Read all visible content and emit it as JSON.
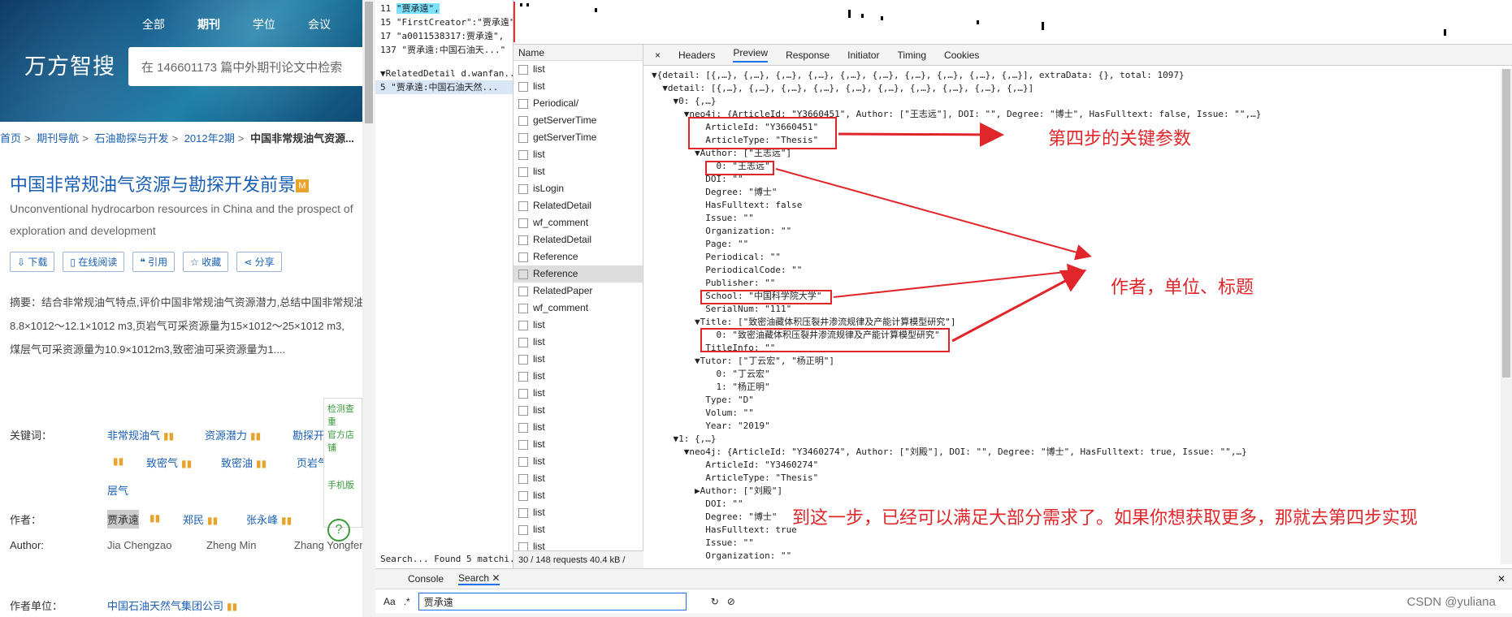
{
  "left": {
    "nav": [
      "全部",
      "期刊",
      "学位",
      "会议"
    ],
    "logo": "万方智搜",
    "search_placeholder": "在 146601173 篇中外期刊论文中检索",
    "breadcrumb": [
      "首页",
      "期刊导航",
      "石油勘探与开发",
      "2012年2期"
    ],
    "breadcrumb_current": "中国非常规油气资源...",
    "title": "中国非常规油气资源与勘探开发前景",
    "title_badge": "M",
    "en_title": "Unconventional hydrocarbon resources in China and the prospect of exploration and development",
    "actions": [
      "下载",
      "在线阅读",
      "引用",
      "收藏",
      "分享"
    ],
    "abstract_label": "摘要：",
    "abstract_lines": [
      "结合非常规油气特点,评价中国非常规油气资源潜力,总结中国非常规油气勘探开发技术进展,阐述中国非常规油气勘探开发前景与未来的发展战略。研究表明,中国非常规油气资源丰富,发展潜力大,其中致密气可采资源量为",
      "8.8×1012～12.1×1012 m3,页岩气可采资源量为15×1012～25×1012 m3,",
      "煤层气可采资源量为10.9×1012m3,致密油可采资源量为1...."
    ],
    "keywords_label": "关键词：",
    "keywords": [
      "非常规油气",
      "资源潜力",
      "勘探开发",
      "致密气",
      "致密油",
      "页岩气",
      "层气"
    ],
    "authors_label": "作者：",
    "authors": [
      "贾承遠",
      "郑民",
      "张永峰"
    ],
    "author_en_label": "Author:",
    "authors_en": [
      "Jia Chengzao",
      "Zheng Min",
      "Zhang Yongfeng"
    ],
    "org_label": "作者单位：",
    "org": "中国石油天然气集团公司",
    "side": [
      "检测查重",
      "官方店铺",
      "手机版"
    ]
  },
  "search_results": [
    {
      "ln": "11",
      "text": "\"贾承遠\","
    },
    {
      "ln": "15",
      "text": "\"FirstCreator\":\"贾承遠\","
    },
    {
      "ln": "17",
      "text": "\"a0011538317:贾承遠\","
    },
    {
      "ln": "137",
      "text": "\"贾承遠:中国石油天...\""
    }
  ],
  "search_group": "▼RelatedDetail   d.wanfan...",
  "search_group_row": "5 \"贾承遠:中国石油天然...",
  "network": {
    "name_header": "Name",
    "requests": [
      "list",
      "list",
      "Periodical/",
      "getServerTime",
      "getServerTime",
      "list",
      "list",
      "isLogin",
      "RelatedDetail",
      "wf_comment",
      "RelatedDetail",
      "Reference",
      "Reference",
      "RelatedPaper",
      "wf_comment",
      "list",
      "list",
      "list",
      "list",
      "list",
      "list",
      "list",
      "list",
      "list",
      "list",
      "list",
      "list",
      "list",
      "list"
    ],
    "status": "30 / 148 requests   40.4 kB /"
  },
  "preview_tabs": [
    "×",
    "Headers",
    "Preview",
    "Response",
    "Initiator",
    "Timing",
    "Cookies"
  ],
  "json_lines": [
    "▼{detail: [{,…}, {,…}, {,…}, {,…}, {,…}, {,…}, {,…}, {,…}, {,…}, {,…}], extraData: {}, total: 1097}",
    "  ▼detail: [{,…}, {,…}, {,…}, {,…}, {,…}, {,…}, {,…}, {,…}, {,…}, {,…}]",
    "    ▼0: {,…}",
    "      ▼neo4j: {ArticleId: \"Y3660451\", Author: [\"王志远\"], DOI: \"\", Degree: \"博士\", HasFulltext: false, Issue: \"\",…}",
    "          ArticleId: \"Y3660451\"",
    "          ArticleType: \"Thesis\"",
    "        ▼Author: [\"王志远\"]",
    "            0: \"王志远\"",
    "          DOI: \"\"",
    "          Degree: \"博士\"",
    "          HasFulltext: false",
    "          Issue: \"\"",
    "          Organization: \"\"",
    "          Page: \"\"",
    "          Periodical: \"\"",
    "          PeriodicalCode: \"\"",
    "          Publisher: \"\"",
    "          School: \"中国科学院大学\"",
    "          SerialNum: \"111\"",
    "        ▼Title: [\"致密油藏体积压裂井渗流规律及产能计算模型研究\"]",
    "            0: \"致密油藏体积压裂井渗流规律及产能计算模型研究\"",
    "          TitleInfo: \"\"",
    "        ▼Tutor: [\"丁云宏\", \"杨正明\"]",
    "            0: \"丁云宏\"",
    "            1: \"杨正明\"",
    "          Type: \"D\"",
    "          Volum: \"\"",
    "          Year: \"2019\"",
    "    ▼1: {,…}",
    "      ▼neo4j: {ArticleId: \"Y3460274\", Author: [\"刘殿\"], DOI: \"\", Degree: \"博士\", HasFulltext: true, Issue: \"\",…}",
    "          ArticleId: \"Y3460274\"",
    "          ArticleType: \"Thesis\"",
    "        ▶Author: [\"刘殿\"]",
    "          DOI: \"\"",
    "          Degree: \"博士\"",
    "          HasFulltext: true",
    "          Issue: \"\"",
    "          Organization: \"\""
  ],
  "annotations": {
    "key_params": "第四步的关键参数",
    "author_org_title": "作者，单位、标题",
    "summary": "到这一步，已经可以满足大部分需求了。如果你想获取更多，那就去第四步实现"
  },
  "bottom": {
    "tabs": [
      "Console",
      "Search"
    ],
    "search_label": "Aa",
    "search_regex": ".*",
    "search_value": "贾承遠",
    "status_left": "Search...  Found 5 matchi..."
  },
  "watermark": "CSDN @yuliana",
  "colors": {
    "annotation": "#e0262a",
    "link": "#1a5fb4",
    "highlight": "#7ce0ff"
  }
}
